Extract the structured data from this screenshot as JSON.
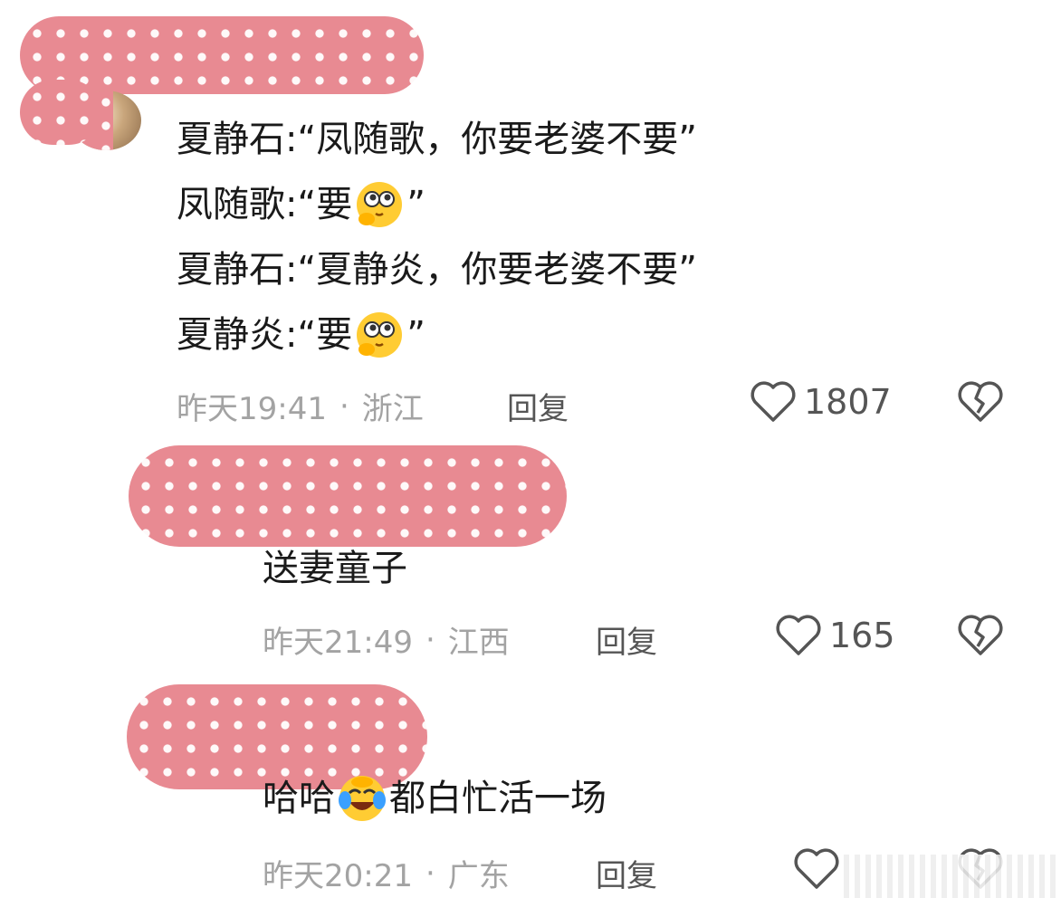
{
  "comments": [
    {
      "lines": [
        {
          "text": "夏静石:“凤随歌，你要老婆不要”",
          "emoji": null
        },
        {
          "text": "凤随歌:“要",
          "emoji": "shy-face-emoji",
          "after": "”"
        },
        {
          "text": "夏静石:“夏静炎，你要老婆不要”",
          "emoji": null
        },
        {
          "text": "夏静炎:“要",
          "emoji": "shy-face-emoji",
          "after": "”"
        }
      ],
      "time": "昨天19:41",
      "dot": "·",
      "location": "浙江",
      "reply_label": "回复",
      "likes": "1807"
    },
    {
      "lines": [
        {
          "text": "送妻童子",
          "emoji": null
        }
      ],
      "time": "昨天21:49",
      "dot": "·",
      "location": "江西",
      "reply_label": "回复",
      "likes": "165"
    },
    {
      "lines": [
        {
          "text": "哈哈",
          "emoji": "laugh-cry-emoji",
          "after": "都白忙活一场"
        }
      ],
      "time": "昨天20:21",
      "dot": "·",
      "location": "广东",
      "reply_label": "回复",
      "likes": ""
    }
  ],
  "colors": {
    "mask": "#e88a92",
    "meta": "#a3a3a3",
    "icon": "#555555"
  }
}
